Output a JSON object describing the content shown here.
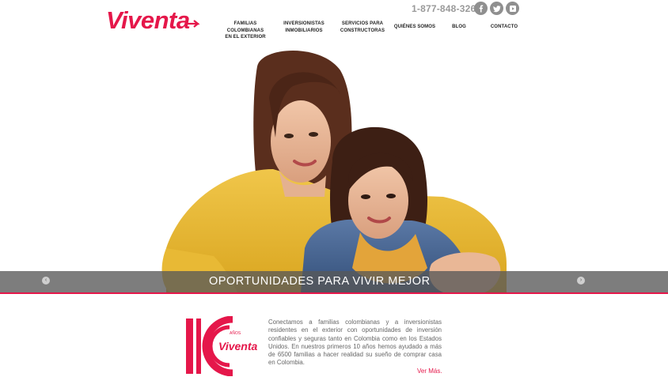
{
  "brand": {
    "name": "Viventa",
    "color": "#e5174a"
  },
  "header": {
    "phone": "1-877-848-3265",
    "social": [
      {
        "name": "facebook-icon",
        "glyph": "f"
      },
      {
        "name": "twitter-icon",
        "glyph": "t"
      },
      {
        "name": "youtube-icon",
        "glyph": "yt"
      }
    ],
    "nav": [
      {
        "line1": "FAMILIAS COLOMBIANAS",
        "line2": "EN EL EXTERIOR"
      },
      {
        "line1": "INVERSIONISTAS",
        "line2": "INMOBILIARIOS"
      },
      {
        "line1": "SERVICIOS PARA",
        "line2": "CONSTRUCTORAS"
      },
      {
        "line1": "QUIÉNES SOMOS",
        "line2": ""
      },
      {
        "line1": "BLOG",
        "line2": ""
      },
      {
        "line1": "CONTACTO",
        "line2": ""
      }
    ]
  },
  "hero": {
    "caption": "OPORTUNIDADES PARA VIVIR MEJOR",
    "prev_label": "‹",
    "next_label": "›"
  },
  "intro": {
    "badge_years": "10",
    "badge_word": "AÑOS",
    "badge_brand": "Viventa",
    "text": "Conectamos a familias colombianas y a inversionistas residentes en el exterior con oportunidades de inversión confiables y seguras tanto en Colombia como en los Estados Unidos. En nuestros primeros 10 años hemos ayudado a más de 6500 familias a hacer realidad su sueño de comprar casa en Colombia.",
    "more_label": "Ver Más."
  }
}
